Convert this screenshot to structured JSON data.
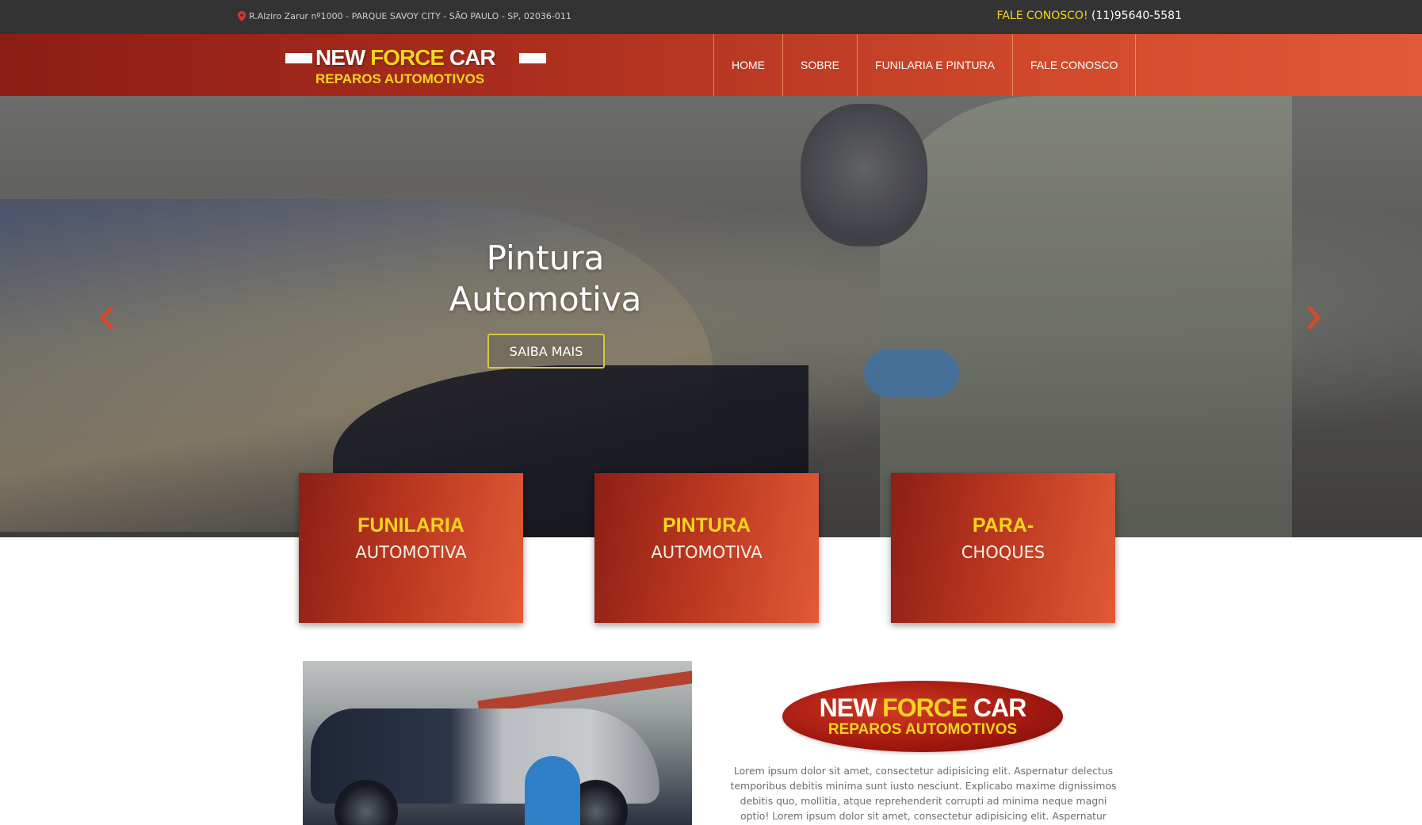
{
  "topbar": {
    "address": "R.Alziro Zarur nº1000 - PARQUE SAVOY CITY - SÃO PAULO - SP, 02036-011",
    "contact_label": "FALE CONOSCO!",
    "contact_phone": "(11)95640-5581",
    "icon": "map-pin-icon"
  },
  "header": {
    "logo": {
      "word1": "NEW",
      "word2": "FORCE",
      "word3": "CAR",
      "tagline": "REPAROS AUTOMOTIVOS"
    },
    "nav": [
      {
        "label": "HOME"
      },
      {
        "label": "SOBRE"
      },
      {
        "label": "FUNILARIA E PINTURA"
      },
      {
        "label": "FALE CONOSCO"
      }
    ]
  },
  "hero": {
    "title_line1": "Pintura",
    "title_line2": "Automotiva",
    "cta_label": "SAIBA MAIS",
    "prev_icon": "chevron-left-icon",
    "next_icon": "chevron-right-icon"
  },
  "services": [
    {
      "top": "FUNILARIA",
      "bottom": "AUTOMOTIVA"
    },
    {
      "top": "PINTURA",
      "bottom": "AUTOMOTIVA"
    },
    {
      "top": "PARA-",
      "bottom": "CHOQUES"
    }
  ],
  "about": {
    "logo": {
      "word1": "NEW",
      "word2": "FORCE",
      "word3": "CAR",
      "tagline": "REPAROS AUTOMOTIVOS"
    },
    "text": "Lorem ipsum dolor sit amet, consectetur adipisicing elit. Aspernatur delectus temporibus debitis minima sunt iusto nesciunt. Explicabo maxime dignissimos debitis quo, mollitia, atque reprehenderit corrupti ad minima neque magni optio! Lorem ipsum dolor sit amet, consectetur adipisicing elit. Aspernatur delectus temporibus debitis"
  },
  "colors": {
    "topbar_bg": "#333333",
    "brand_red": "#a82c1d",
    "brand_orange": "#e2593a",
    "accent_yellow": "#f3d51e"
  }
}
